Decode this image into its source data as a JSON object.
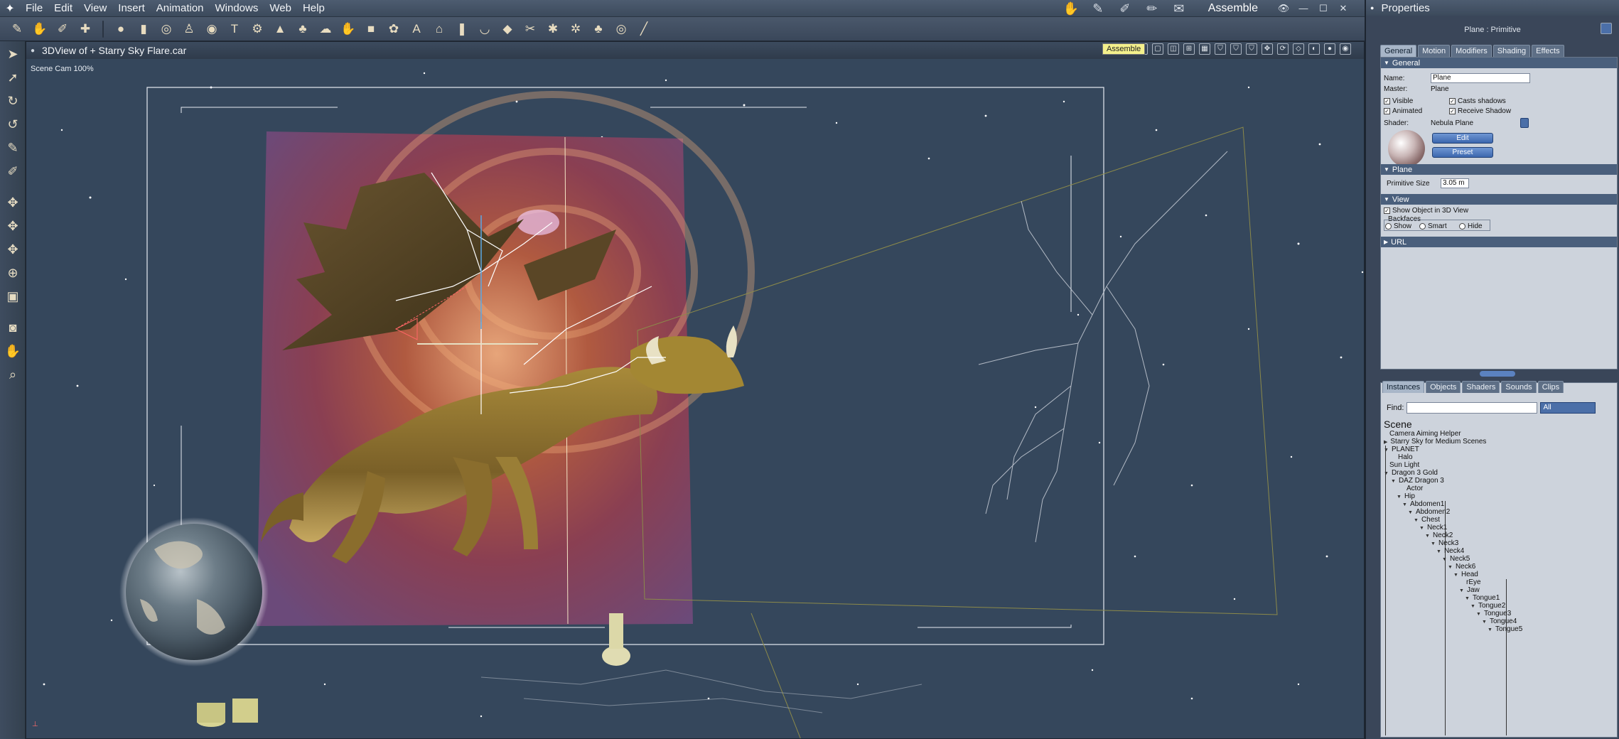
{
  "menubar": {
    "items": [
      "File",
      "Edit",
      "View",
      "Insert",
      "Animation",
      "Windows",
      "Web",
      "Help"
    ],
    "mode": "Assemble"
  },
  "viewport": {
    "title": "3DView of + Starry Sky Flare.car",
    "camera": "Scene Cam 100%",
    "tooltip": "Assemble"
  },
  "properties": {
    "title": "Properties",
    "subtitle": "Plane : Primitive",
    "tabs": [
      "General",
      "Motion",
      "Modifiers",
      "Shading",
      "Effects"
    ],
    "general": {
      "section": "General",
      "name_label": "Name:",
      "name_value": "Plane",
      "master_label": "Master:",
      "master_value": "Plane",
      "visible": "Visible",
      "animated": "Animated",
      "casts_shadows": "Casts shadows",
      "receive_shadow": "Receive Shadow",
      "shader_label": "Shader:",
      "shader_value": "Nebula Plane",
      "edit_btn": "Edit",
      "preset_btn": "Preset"
    },
    "plane": {
      "section": "Plane",
      "size_label": "Primitive Size",
      "size_value": "3.05 m"
    },
    "view": {
      "section": "View",
      "show_label": "Show Object in 3D View",
      "backfaces": "Backfaces",
      "opt_show": "Show",
      "opt_smart": "Smart",
      "opt_hide": "Hide"
    },
    "url": {
      "section": "URL"
    }
  },
  "instances": {
    "tabs": [
      "Instances",
      "Objects",
      "Shaders",
      "Sounds",
      "Clips"
    ],
    "find_label": "Find:",
    "filter": "All",
    "scene_label": "Scene",
    "tree": [
      "Camera Aiming Helper",
      "Starry Sky for Medium Scenes",
      "PLANET",
      "Halo",
      "Sun Light",
      "Dragon 3 Gold",
      "DAZ Dragon 3",
      "Actor",
      "Hip",
      "Abdomen1",
      "Abdomen2",
      "Chest",
      "Neck1",
      "Neck2",
      "Neck3",
      "Neck4",
      "Neck5",
      "Neck6",
      "Head",
      "rEye",
      "Jaw",
      "Tongue1",
      "Tongue2",
      "Tongue3",
      "Tongue4",
      "Tongue5"
    ]
  }
}
